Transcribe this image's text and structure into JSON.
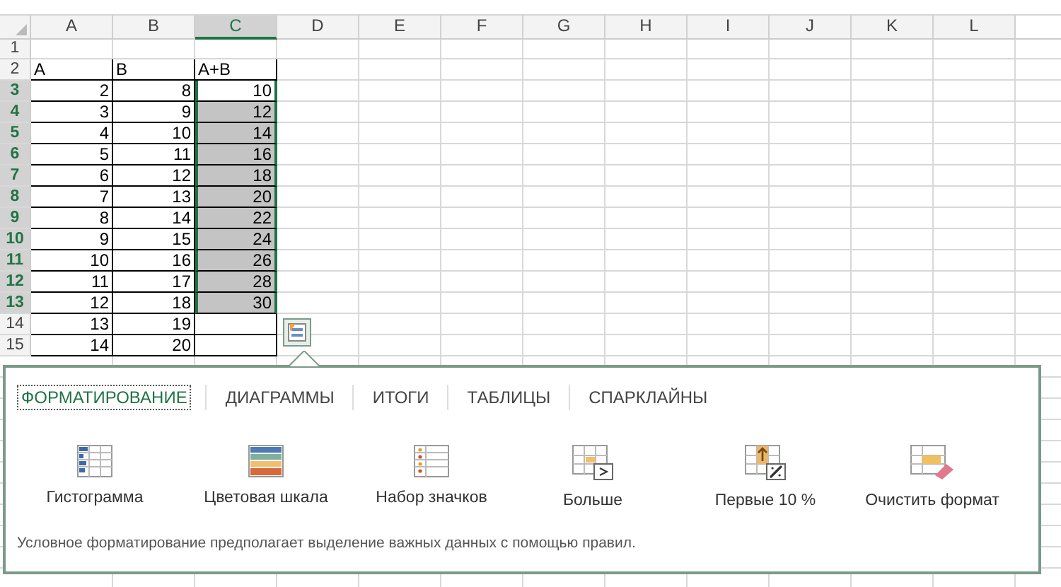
{
  "sheet": {
    "columns": [
      {
        "label": "A",
        "selected": false
      },
      {
        "label": "B",
        "selected": false
      },
      {
        "label": "C",
        "selected": true
      },
      {
        "label": "D",
        "selected": false
      },
      {
        "label": "E",
        "selected": false
      },
      {
        "label": "F",
        "selected": false
      },
      {
        "label": "G",
        "selected": false
      },
      {
        "label": "H",
        "selected": false
      },
      {
        "label": "I",
        "selected": false
      },
      {
        "label": "J",
        "selected": false
      },
      {
        "label": "K",
        "selected": false
      },
      {
        "label": "L",
        "selected": false
      }
    ],
    "rows": [
      {
        "number": "1",
        "selected": false,
        "cells": []
      },
      {
        "number": "2",
        "selected": false,
        "cells": [
          {
            "value": "A",
            "highlighted": false
          },
          {
            "value": "B",
            "highlighted": false
          },
          {
            "value": "A+B",
            "highlighted": false
          }
        ]
      },
      {
        "number": "3",
        "selected": true,
        "cells": [
          {
            "value": "2",
            "highlighted": false
          },
          {
            "value": "8",
            "highlighted": false
          },
          {
            "value": "10",
            "highlighted": false
          }
        ]
      },
      {
        "number": "4",
        "selected": true,
        "cells": [
          {
            "value": "3",
            "highlighted": false
          },
          {
            "value": "9",
            "highlighted": false
          },
          {
            "value": "12",
            "highlighted": true
          }
        ]
      },
      {
        "number": "5",
        "selected": true,
        "cells": [
          {
            "value": "4",
            "highlighted": false
          },
          {
            "value": "10",
            "highlighted": false
          },
          {
            "value": "14",
            "highlighted": true
          }
        ]
      },
      {
        "number": "6",
        "selected": true,
        "cells": [
          {
            "value": "5",
            "highlighted": false
          },
          {
            "value": "11",
            "highlighted": false
          },
          {
            "value": "16",
            "highlighted": true
          }
        ]
      },
      {
        "number": "7",
        "selected": true,
        "cells": [
          {
            "value": "6",
            "highlighted": false
          },
          {
            "value": "12",
            "highlighted": false
          },
          {
            "value": "18",
            "highlighted": true
          }
        ]
      },
      {
        "number": "8",
        "selected": true,
        "cells": [
          {
            "value": "7",
            "highlighted": false
          },
          {
            "value": "13",
            "highlighted": false
          },
          {
            "value": "20",
            "highlighted": true
          }
        ]
      },
      {
        "number": "9",
        "selected": true,
        "cells": [
          {
            "value": "8",
            "highlighted": false
          },
          {
            "value": "14",
            "highlighted": false
          },
          {
            "value": "22",
            "highlighted": true
          }
        ]
      },
      {
        "number": "10",
        "selected": true,
        "cells": [
          {
            "value": "9",
            "highlighted": false
          },
          {
            "value": "15",
            "highlighted": false
          },
          {
            "value": "24",
            "highlighted": true
          }
        ]
      },
      {
        "number": "11",
        "selected": true,
        "cells": [
          {
            "value": "10",
            "highlighted": false
          },
          {
            "value": "16",
            "highlighted": false
          },
          {
            "value": "26",
            "highlighted": true
          }
        ]
      },
      {
        "number": "12",
        "selected": true,
        "cells": [
          {
            "value": "11",
            "highlighted": false
          },
          {
            "value": "17",
            "highlighted": false
          },
          {
            "value": "28",
            "highlighted": true
          }
        ]
      },
      {
        "number": "13",
        "selected": true,
        "cells": [
          {
            "value": "12",
            "highlighted": false
          },
          {
            "value": "18",
            "highlighted": false
          },
          {
            "value": "30",
            "highlighted": true
          }
        ]
      },
      {
        "number": "14",
        "selected": false,
        "cells": [
          {
            "value": "13",
            "highlighted": false
          },
          {
            "value": "19",
            "highlighted": false
          },
          {
            "highlighted": false
          }
        ]
      },
      {
        "number": "15",
        "selected": false,
        "cells": [
          {
            "value": "14",
            "highlighted": false
          },
          {
            "value": "20",
            "highlighted": false
          },
          {
            "highlighted": false
          }
        ]
      }
    ]
  },
  "quick_analysis": {
    "tabs": [
      {
        "label": "ФОРМАТИРОВАНИЕ",
        "selected": true
      },
      {
        "label": "ДИАГРАММЫ",
        "selected": false
      },
      {
        "label": "ИТОГИ",
        "selected": false
      },
      {
        "label": "ТАБЛИЦЫ",
        "selected": false
      },
      {
        "label": "СПАРКЛАЙНЫ",
        "selected": false
      }
    ],
    "options": [
      {
        "kind": "databar",
        "label": "Гистограмма"
      },
      {
        "kind": "colorscale",
        "label": "Цветовая шкала"
      },
      {
        "kind": "iconset",
        "label": "Набор значков"
      },
      {
        "kind": "greater",
        "label": "Больше"
      },
      {
        "kind": "top",
        "label": "Первые 10 %"
      },
      {
        "kind": "clear",
        "label": "Очистить формат"
      }
    ],
    "description": "Условное форматирование предполагает выделение важных данных с помощью правил."
  }
}
